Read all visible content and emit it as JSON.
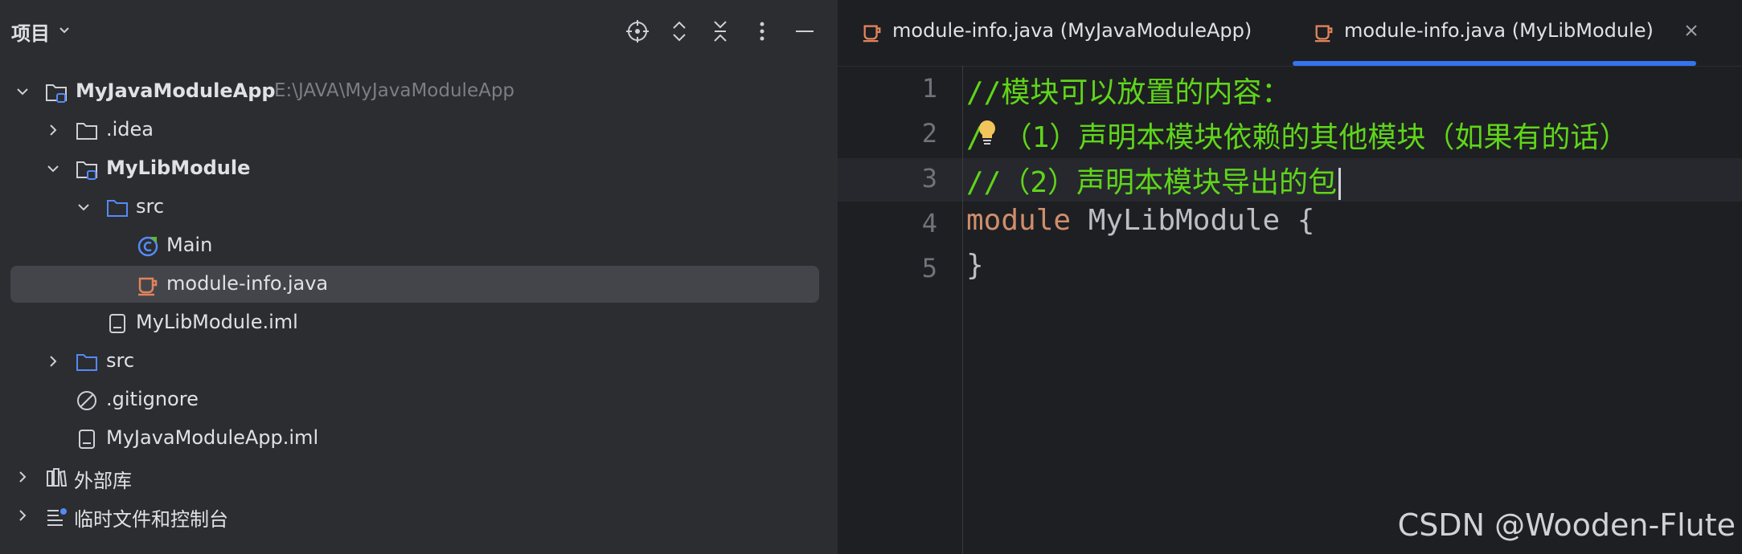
{
  "project_panel": {
    "title": "项目",
    "tree": [
      {
        "label": "MyJavaModuleApp",
        "path": "E:\\JAVA\\MyJavaModuleApp"
      },
      {
        "label": ".idea"
      },
      {
        "label": "MyLibModule"
      },
      {
        "label": "src"
      },
      {
        "label": "Main"
      },
      {
        "label": "module-info.java",
        "selected": true
      },
      {
        "label": "MyLibModule.iml"
      },
      {
        "label": "src"
      },
      {
        "label": ".gitignore"
      },
      {
        "label": "MyJavaModuleApp.iml"
      },
      {
        "label": "外部库"
      },
      {
        "label": "临时文件和控制台"
      }
    ]
  },
  "editor": {
    "tabs": [
      {
        "label": "module-info.java (MyJavaModuleApp)"
      },
      {
        "label": "module-info.java (MyLibModule)",
        "active": true
      }
    ],
    "line_numbers": [
      "1",
      "2",
      "3",
      "4",
      "5"
    ],
    "lines": {
      "l1": "//模块可以放置的内容：",
      "l2_a": "/",
      "l2_b": "（1）声明本模块依赖的其他模块（如果有的话）",
      "l3": "//（2）声明本模块导出的包",
      "l4_kw": "module",
      "l4_rest": " MyLibModule {",
      "l5": "}"
    }
  },
  "watermark": "CSDN @Wooden-Flute",
  "colors": {
    "accent": "#3574f0",
    "comment": "#5fd51a",
    "keyword": "#cf8e6d",
    "text": "#bcbec4",
    "java_icon": "#e0845c",
    "folder_icon": "#548af7"
  }
}
